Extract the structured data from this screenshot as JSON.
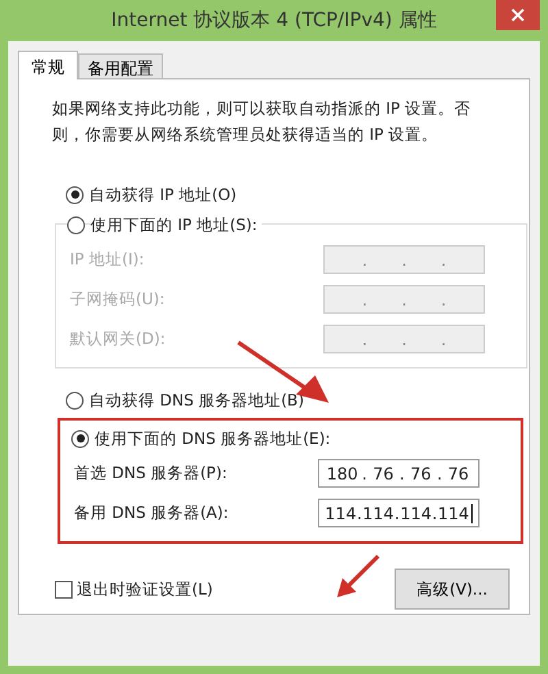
{
  "window": {
    "title": "Internet 协议版本 4 (TCP/IPv4) 属性"
  },
  "tabs": [
    {
      "label": "常规",
      "selected": true
    },
    {
      "label": "备用配置",
      "selected": false
    }
  ],
  "description": "如果网络支持此功能，则可以获取自动指派的 IP 设置。否则，你需要从网络系统管理员处获得适当的 IP 设置。",
  "ip_separator": ".",
  "ip_section": {
    "options": [
      {
        "label": "自动获得 IP 地址(O)",
        "selected": true
      },
      {
        "label": "使用下面的 IP 地址(S):",
        "selected": false
      }
    ],
    "disabled": true,
    "fields": [
      {
        "label": "IP 地址(I):"
      },
      {
        "label": "子网掩码(U):"
      },
      {
        "label": "默认网关(D):"
      }
    ]
  },
  "dns_section": {
    "options": [
      {
        "label": "自动获得 DNS 服务器地址(B)",
        "selected": false
      },
      {
        "label": "使用下面的 DNS 服务器地址(E):",
        "selected": true
      }
    ],
    "disabled": false,
    "fields": [
      {
        "label": "首选 DNS 服务器(P):",
        "octets": [
          "180",
          "76",
          "76",
          "76"
        ]
      },
      {
        "label": "备用 DNS 服务器(A):",
        "octets": [
          "114",
          "114",
          "114",
          "114"
        ],
        "focused": true
      }
    ]
  },
  "validate_checkbox": {
    "label": "退出时验证设置(L)",
    "checked": false
  },
  "advanced_button": "高级(V)..."
}
